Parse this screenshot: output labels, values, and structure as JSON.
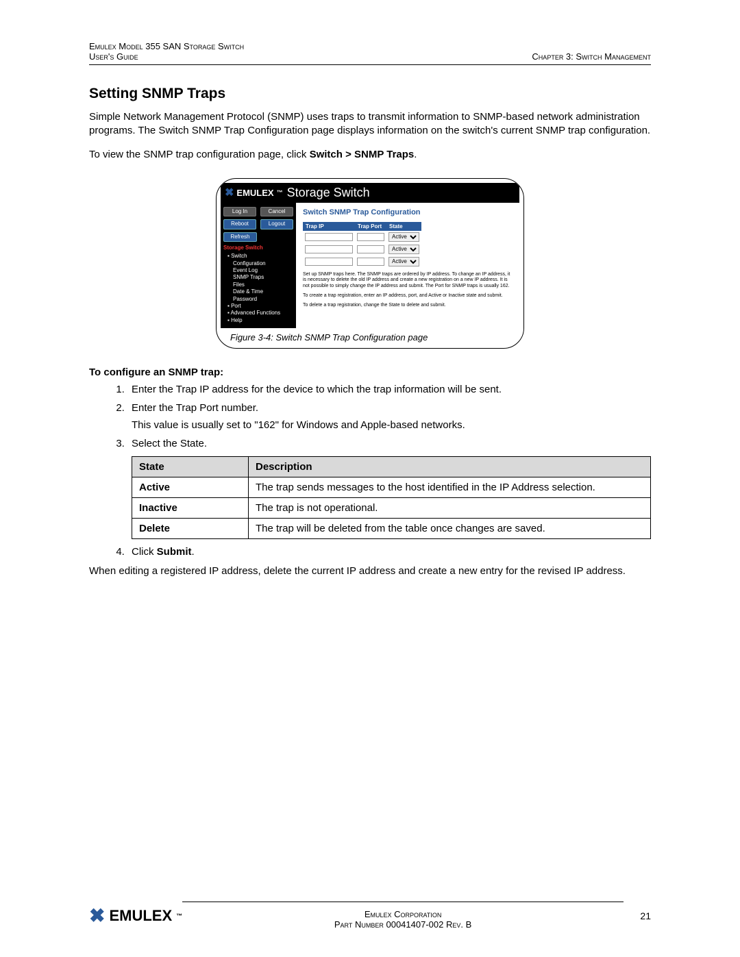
{
  "header": {
    "product": "Emulex Model 355 SAN Storage Switch",
    "guide": "User's Guide",
    "chapter": "Chapter 3: Switch Management"
  },
  "section_title": "Setting SNMP Traps",
  "intro1": "Simple Network Management Protocol (SNMP) uses traps to transmit information to SNMP-based network administration programs. The Switch SNMP Trap Configuration page displays information on the switch's current SNMP trap configuration.",
  "intro2_pre": "To view the SNMP trap configuration page, click ",
  "intro2_bold": "Switch > SNMP Traps",
  "intro2_post": ".",
  "screenshot": {
    "brand": "EMULEX",
    "tm": "™",
    "title": "Storage Switch",
    "buttons": {
      "login": "Log In",
      "cancel": "Cancel",
      "reboot": "Reboot",
      "logout": "Logout",
      "refresh": "Refresh"
    },
    "tree": {
      "root": "Storage Switch",
      "switch": "Switch",
      "items": [
        "Configuration",
        "Event Log",
        "SNMP Traps",
        "Files",
        "Date & Time",
        "Password"
      ],
      "port": "Port",
      "adv": "Advanced Functions",
      "help": "Help"
    },
    "content_title": "Switch SNMP Trap Configuration",
    "cols": {
      "ip": "Trap IP",
      "port": "Trap Port",
      "state": "State"
    },
    "state_options": [
      "Active",
      "Active",
      "Active"
    ],
    "help1": "Set up SNMP traps here. The SNMP traps are ordered by IP address. To change an IP address, it is necessary to delete the old IP address and create a new registration on a new IP address. It is not possible to simply change the IP address and submit. The Port for SNMP traps is usually 162.",
    "help2": "To create a trap registration, enter an IP address, port, and Active or Inactive state and submit.",
    "help3": "To delete a trap registration, change the State to delete and submit."
  },
  "fig_caption": "Figure 3-4: Switch SNMP Trap Configuration page",
  "config_head": "To configure an SNMP trap:",
  "steps": {
    "s1": "Enter the Trap IP address for the device to which the trap information will be sent.",
    "s2": "Enter the Trap Port number.",
    "s2note": "This value is usually set to \"162\" for Windows and Apple-based networks.",
    "s3": "Select the State.",
    "s4_pre": "Click ",
    "s4_bold": "Submit",
    "s4_post": "."
  },
  "table": {
    "h1": "State",
    "h2": "Description",
    "r1k": "Active",
    "r1v": "The trap sends messages to the host identified in the IP Address selection.",
    "r2k": "Inactive",
    "r2v": "The trap is not operational.",
    "r3k": "Delete",
    "r3v": "The trap will be deleted from the table once changes are saved."
  },
  "closing": "When editing a registered IP address, delete the current IP address and create a new entry for the revised IP address.",
  "footer": {
    "brand": "EMULEX",
    "corp": "Emulex Corporation",
    "part": "Part Number 00041407-002 Rev. B",
    "page": "21"
  }
}
